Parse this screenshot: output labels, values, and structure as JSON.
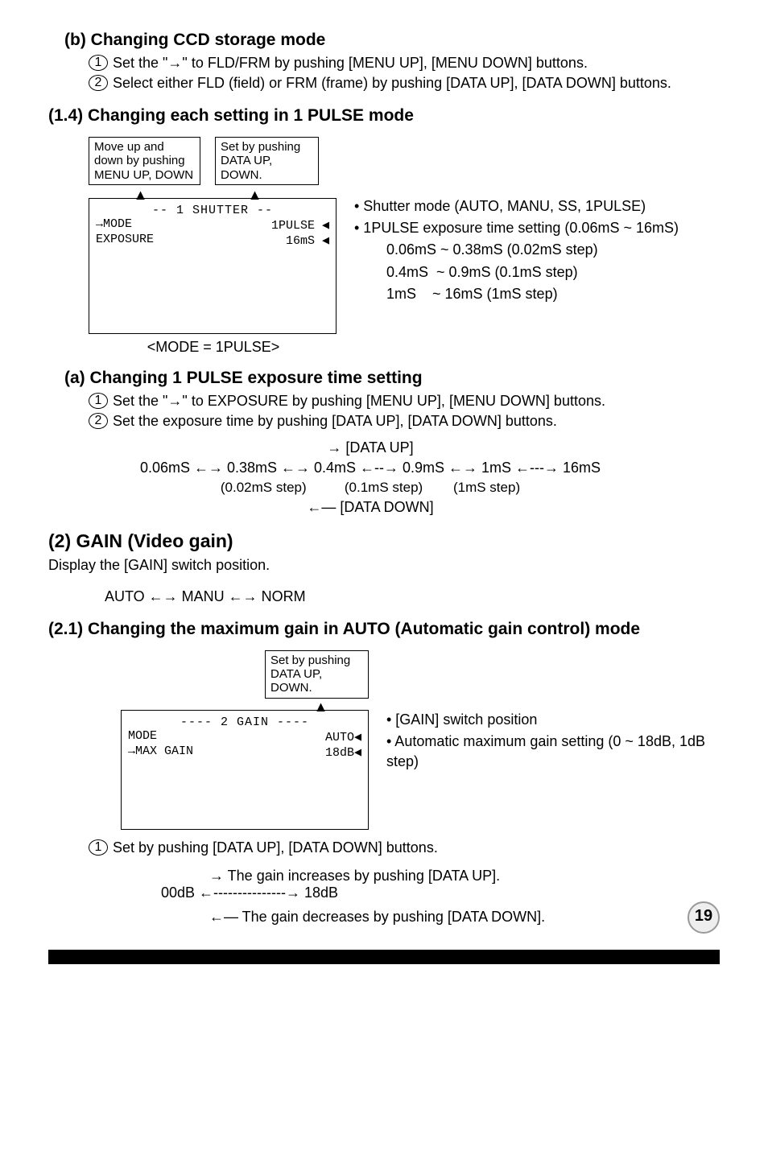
{
  "section_b": {
    "heading": "(b) Changing CCD storage mode",
    "step1": "Set the \"→\" to FLD/FRM by pushing [MENU UP], [MENU DOWN] buttons.",
    "step2": "Select either FLD (field) or FRM (frame) by pushing [DATA UP], [DATA DOWN] buttons."
  },
  "section_1_4": {
    "heading": "(1.4) Changing each setting in 1 PULSE mode",
    "box_label_left": "Move up and down by pushing MENU UP, DOWN",
    "box_label_right": "Set by pushing DATA UP, DOWN.",
    "screen": {
      "title_line": "-- 1 SHUTTER --",
      "row1_left": "→MODE",
      "row1_right": "1PULSE ◀",
      "row2_left": "  EXPOSURE",
      "row2_right": "16mS ◀"
    },
    "annot": {
      "a1": "• Shutter mode (AUTO, MANU, SS, 1PULSE)",
      "a2": "• 1PULSE exposure time setting (0.06mS ~ 16mS)",
      "r1": "0.06mS ~ 0.38mS (0.02mS step)",
      "r2": "0.4mS  ~ 0.9mS (0.1mS step)",
      "r3": "1mS    ~ 16mS (1mS step)"
    },
    "caption": "<MODE = 1PULSE>"
  },
  "section_a": {
    "heading": "(a) Changing 1 PULSE exposure time setting",
    "step1": "Set the \"→\" to EXPOSURE by pushing [MENU UP], [MENU DOWN] buttons.",
    "step2": "Set the exposure time by pushing [DATA UP], [DATA DOWN] buttons.",
    "up_label": "→ [DATA UP]",
    "range": "0.06mS ←→ 0.38mS ←→ 0.4mS ←--→ 0.9mS ←→ 1mS ←---→ 16mS",
    "steps_line": "(0.02mS step)          (0.1mS step)        (1mS step)",
    "down_label": "←— [DATA DOWN]"
  },
  "section_2": {
    "heading": "(2) GAIN (Video gain)",
    "para": "Display the [GAIN] switch position.",
    "modes": "AUTO ←→ MANU ←→ NORM"
  },
  "section_2_1": {
    "heading": "(2.1) Changing the maximum gain in AUTO (Automatic gain control) mode",
    "box_label": "Set by pushing DATA UP, DOWN.",
    "screen": {
      "title_line": "---- 2 GAIN ----",
      "row1_left": "  MODE",
      "row1_right": "AUTO◀",
      "row2_left": "→MAX GAIN",
      "row2_right": "18dB◀"
    },
    "annot": {
      "a1": "• [GAIN] switch position",
      "a2": "• Automatic maximum gain setting (0 ~ 18dB, 1dB step)"
    },
    "step1": "Set by pushing [DATA UP], [DATA DOWN] buttons.",
    "up_label": "→ The gain increases by pushing [DATA UP].",
    "range": "00dB ←---------------→ 18dB",
    "down_label": "←— The gain decreases by pushing [DATA DOWN]."
  },
  "page_number": "19",
  "chart_data": [
    {
      "type": "table",
      "title": "1PULSE exposure time ranges",
      "columns": [
        "range_start_mS",
        "range_end_mS",
        "step_mS"
      ],
      "rows": [
        [
          0.06,
          0.38,
          0.02
        ],
        [
          0.4,
          0.9,
          0.1
        ],
        [
          1,
          16,
          1
        ]
      ]
    },
    {
      "type": "table",
      "title": "AUTO maximum gain setting",
      "columns": [
        "min_dB",
        "max_dB",
        "step_dB"
      ],
      "rows": [
        [
          0,
          18,
          1
        ]
      ]
    }
  ]
}
